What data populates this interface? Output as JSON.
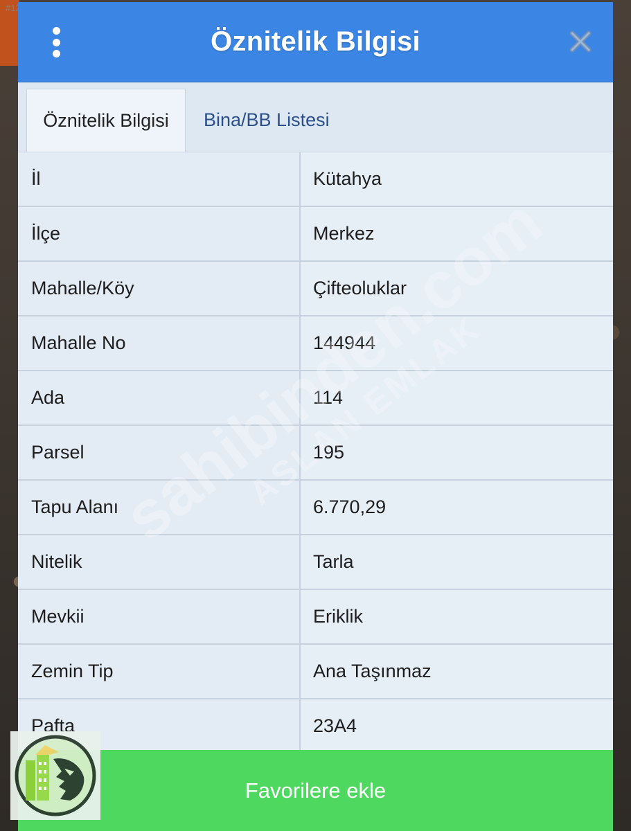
{
  "window": {
    "title": "Öznitelik Bilgisi",
    "background_id": "#1287571300"
  },
  "tabs": [
    {
      "label": "Öznitelik Bilgisi",
      "active": true
    },
    {
      "label": "Bina/BB Listesi",
      "active": false
    }
  ],
  "attributes": [
    {
      "key": "İl",
      "value": "Kütahya"
    },
    {
      "key": "İlçe",
      "value": "Merkez"
    },
    {
      "key": "Mahalle/Köy",
      "value": "Çifteoluklar"
    },
    {
      "key": "Mahalle No",
      "value": "144944"
    },
    {
      "key": "Ada",
      "value": "114"
    },
    {
      "key": "Parsel",
      "value": "195"
    },
    {
      "key": "Tapu Alanı",
      "value": "6.770,29"
    },
    {
      "key": "Nitelik",
      "value": "Tarla"
    },
    {
      "key": "Mevkii",
      "value": "Eriklik"
    },
    {
      "key": "Zemin Tip",
      "value": "Ana Taşınmaz"
    },
    {
      "key": "Pafta",
      "value": "23A4"
    }
  ],
  "footer": {
    "favorite_label": "Favorilere ekle"
  },
  "watermark": {
    "line1": "sahibinden.com",
    "line2": "ASLAN EMLAK"
  },
  "icons": {
    "menu": "kebab-menu-icon",
    "close": "close-icon",
    "logo": "lion-building-logo-icon"
  },
  "colors": {
    "header": "#3b86e4",
    "favorite_button": "#4ed860",
    "panel": "#dfe9f2",
    "tab_inactive_text": "#2c4f8a"
  }
}
